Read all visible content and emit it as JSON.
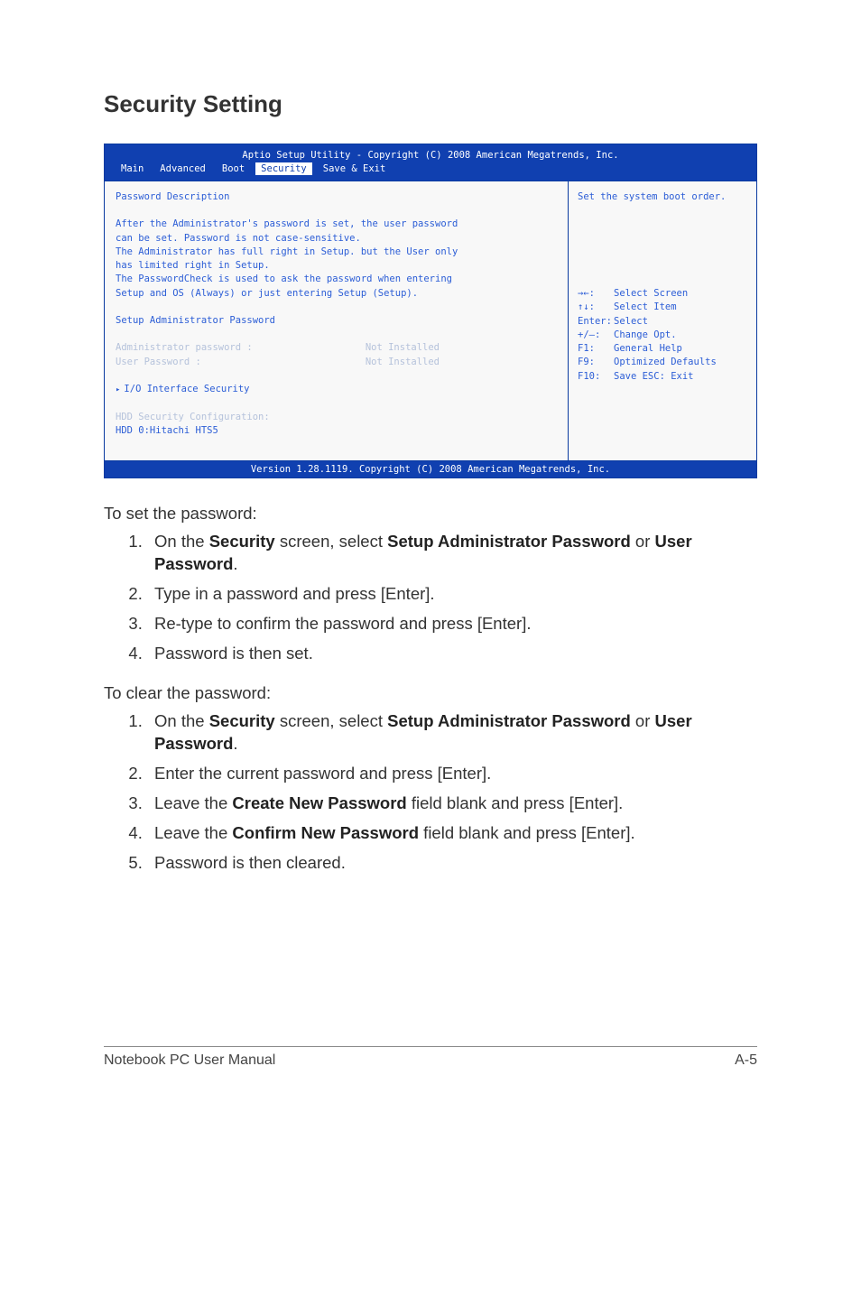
{
  "section": {
    "title": "Security Setting"
  },
  "bios": {
    "title_line": "Aptio Setup Utility - Copyright (C) 2008 American Megatrends, Inc.",
    "tabs": {
      "main": "Main",
      "advanced": "Advanced",
      "boot": "Boot",
      "security": "Security",
      "saveexit": "Save & Exit"
    },
    "left": {
      "pwd_desc": "Password Description",
      "l1": "After the Administrator's password is set, the user password",
      "l2": "can be set. Password is not case-sensitive.",
      "l3": "The Administrator has full right in Setup. but the User only",
      "l4": "has limited right in Setup.",
      "l5": "The PasswordCheck is used to ask the password when entering",
      "l6": "Setup and OS (Always) or just entering Setup (Setup).",
      "setup_admin_pwd": "Setup Administrator Password",
      "admin_pwd_label": "Administrator password   :",
      "admin_pwd_value": "Not Installed",
      "user_pwd_label": "User Password            :",
      "user_pwd_value": "Not Installed",
      "io_security": "I/O Interface Security",
      "hdd_sec_cfg": "HDD Security Configuration:",
      "hdd0": "HDD 0:Hitachi HTS5"
    },
    "right": {
      "hint": "Set the system boot order.",
      "h1k": "→←:",
      "h1v": "Select Screen",
      "h2k": "↑↓:",
      "h2v": "Select Item",
      "h3k": "Enter:",
      "h3v": "Select",
      "h4k": "+/—:",
      "h4v": "Change Opt.",
      "h5k": "F1:",
      "h5v": "General Help",
      "h6k": "F9:",
      "h6v": "Optimized Defaults",
      "h7k": "F10:",
      "h7v": "Save    ESC: Exit"
    },
    "footer": "Version 1.28.1119. Copyright (C) 2008 American Megatrends, Inc."
  },
  "doc": {
    "set_intro": "To set the password:",
    "set_steps": {
      "s1_pre": "On the ",
      "s1_b1": "Security",
      "s1_mid": " screen, select ",
      "s1_b2": "Setup Administrator Password",
      "s1_or": " or ",
      "s1_b3": "User Password",
      "s1_end": ".",
      "s2": "Type in a password and press [Enter].",
      "s3": "Re-type to confirm the password and press [Enter].",
      "s4": "Password is then set."
    },
    "clear_intro": "To clear the password:",
    "clear_steps": {
      "c1_pre": "On the ",
      "c1_b1": "Security",
      "c1_mid": " screen, select ",
      "c1_b2": "Setup Administrator Password",
      "c1_or": " or ",
      "c1_b3": "User Password",
      "c1_end": ".",
      "c2": "Enter the current password and press [Enter].",
      "c3_pre": "Leave the ",
      "c3_b": "Create New Password",
      "c3_end": " field blank and press [Enter].",
      "c4_pre": "Leave the ",
      "c4_b": "Confirm New Password",
      "c4_end": " field blank and press [Enter].",
      "c5": "Password is then cleared."
    }
  },
  "footer": {
    "left": "Notebook PC User Manual",
    "right": "A-5"
  }
}
